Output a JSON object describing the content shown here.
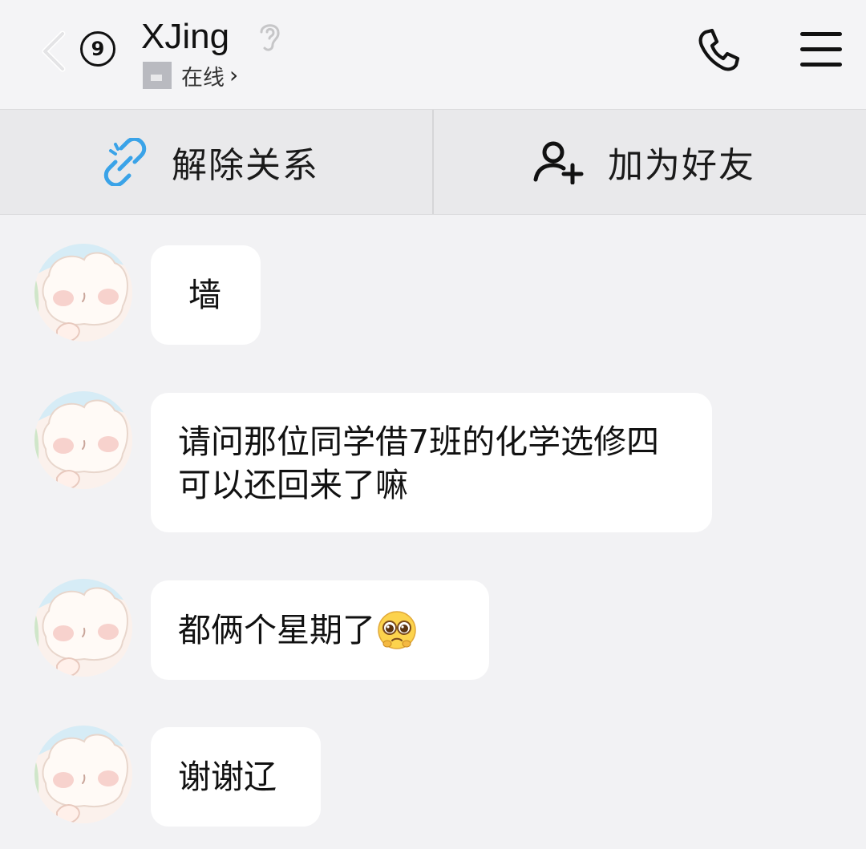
{
  "header": {
    "unread_count": "9",
    "contact_name": "XJing",
    "status": "在线",
    "status_chevron": "›"
  },
  "actions": {
    "unlink_label": "解除关系",
    "add_friend_label": "加为好友"
  },
  "messages": [
    {
      "text": "墙"
    },
    {
      "text": "请问那位同学借7班的化学选修四可以还回来了嘛"
    },
    {
      "text": "都俩个星期了",
      "emoji": "pleading-face-emoji"
    },
    {
      "text": "谢谢辽"
    }
  ],
  "colors": {
    "page_background": "#f2f2f4",
    "action_bar_background": "#e9e9eb",
    "bubble_background": "#ffffff",
    "unlink_icon_accent": "#3aa3e8"
  },
  "icons": {
    "back": "back-chevron-icon",
    "ear": "ear-icon",
    "phone": "phone-icon",
    "menu": "hamburger-menu-icon",
    "unlink": "broken-link-icon",
    "add_friend": "add-person-icon"
  }
}
